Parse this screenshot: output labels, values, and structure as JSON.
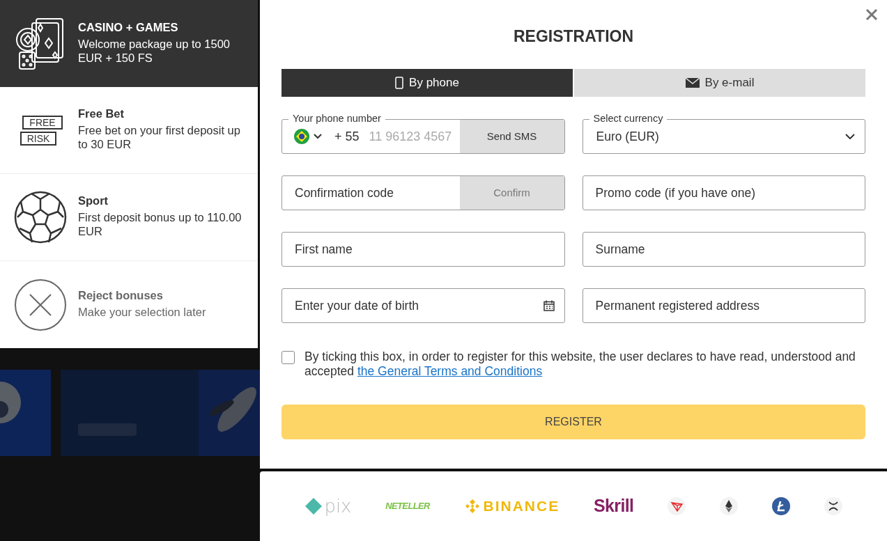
{
  "bonuses": [
    {
      "kind": "casino",
      "title": "CASINO + GAMES",
      "description": "Welcome package up to 1500 EUR + 150 FS",
      "selected": true
    },
    {
      "kind": "freebet",
      "title": "Free Bet",
      "description": "Free bet on your first deposit up to 30 EUR",
      "icon_labels": [
        "FREE",
        "RISK"
      ],
      "selected": false
    },
    {
      "kind": "sport",
      "title": "Sport",
      "description": "First deposit bonus up to 110.00 EUR",
      "selected": false
    },
    {
      "kind": "reject",
      "title": "Reject bonuses",
      "description": "Make your selection later",
      "selected": false
    }
  ],
  "registration": {
    "title": "REGISTRATION",
    "tabs": [
      {
        "kind": "phone",
        "label": "By phone",
        "selected": true
      },
      {
        "kind": "email",
        "label": "By e-mail",
        "selected": false
      }
    ],
    "fields": [
      {
        "kind": "phone",
        "label": "Your phone number",
        "code": "+ 55",
        "placeholder": "11 96123 4567",
        "button": "Send SMS"
      },
      {
        "kind": "select",
        "label": "Select currency",
        "value": "Euro (EUR)"
      },
      {
        "kind": "code",
        "placeholder": "Confirmation code",
        "button": "Confirm"
      },
      {
        "kind": "text",
        "placeholder": "Promo code (if you have one)"
      },
      {
        "kind": "text",
        "placeholder": "First name"
      },
      {
        "kind": "text",
        "placeholder": "Surname"
      },
      {
        "kind": "date",
        "placeholder": "Enter your date of birth"
      },
      {
        "kind": "text",
        "placeholder": "Permanent registered address"
      }
    ],
    "consent": {
      "checked": false,
      "text": "By ticking this box, in order to register for this website, the user declares to have read, understood and accepted ",
      "link": "the General Terms and Conditions"
    },
    "submit": "REGISTER"
  },
  "payments": [
    {
      "kind": "pix",
      "text": "pix"
    },
    {
      "kind": "neteller",
      "text": "NETELLER"
    },
    {
      "kind": "binance",
      "text": "BINANCE"
    },
    {
      "kind": "skrill",
      "text": "Skrill"
    },
    {
      "kind": "tron"
    },
    {
      "kind": "ethereum"
    },
    {
      "kind": "litecoin"
    },
    {
      "kind": "xrp"
    }
  ]
}
